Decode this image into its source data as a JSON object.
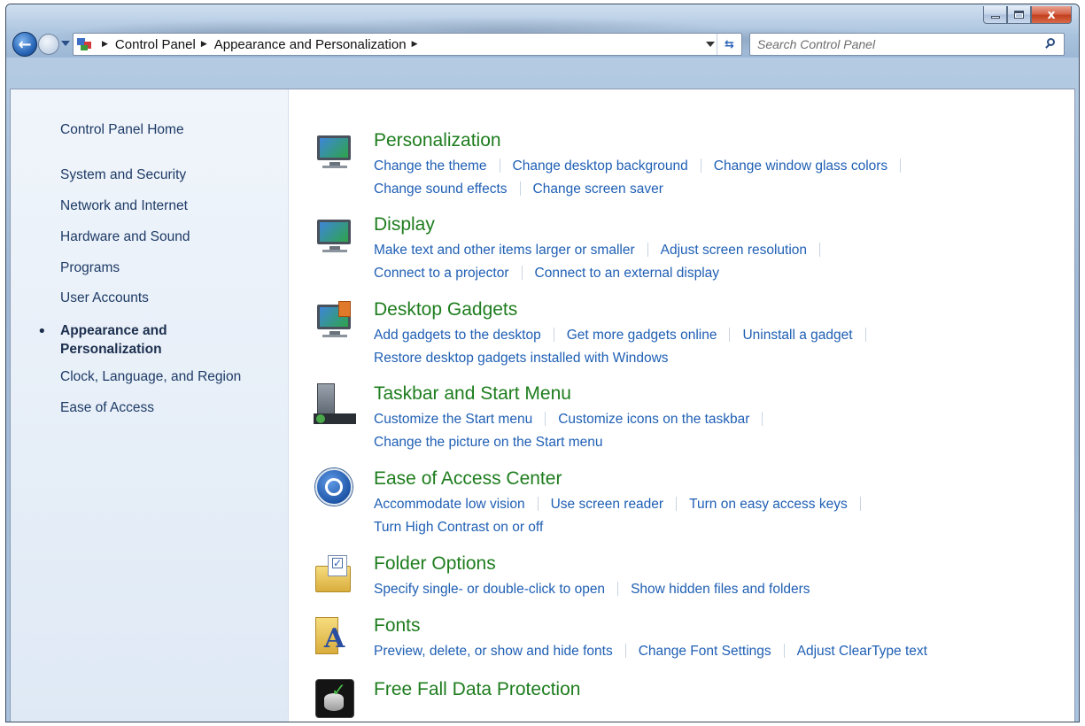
{
  "window": {
    "caption_close": "x"
  },
  "navigation": {
    "breadcrumbs": [
      "Control Panel",
      "Appearance and Personalization"
    ],
    "search_placeholder": "Search Control Panel"
  },
  "sidebar": {
    "items": [
      {
        "label": "Control Panel Home"
      },
      {
        "label": "System and Security"
      },
      {
        "label": "Network and Internet"
      },
      {
        "label": "Hardware and Sound"
      },
      {
        "label": "Programs"
      },
      {
        "label": "User Accounts"
      },
      {
        "label": "Appearance and Personalization",
        "selected": true
      },
      {
        "label": "Clock, Language, and Region"
      },
      {
        "label": "Ease of Access"
      }
    ]
  },
  "categories": [
    {
      "title": "Personalization",
      "icon": "personalization-icon",
      "links": [
        "Change the theme",
        "Change desktop background",
        "Change window glass colors",
        "Change sound effects",
        "Change screen saver"
      ]
    },
    {
      "title": "Display",
      "icon": "display-icon",
      "links": [
        "Make text and other items larger or smaller",
        "Adjust screen resolution",
        "Connect to a projector",
        "Connect to an external display"
      ]
    },
    {
      "title": "Desktop Gadgets",
      "icon": "desktop-gadgets-icon",
      "links": [
        "Add gadgets to the desktop",
        "Get more gadgets online",
        "Uninstall a gadget",
        "Restore desktop gadgets installed with Windows"
      ]
    },
    {
      "title": "Taskbar and Start Menu",
      "icon": "taskbar-icon",
      "links": [
        "Customize the Start menu",
        "Customize icons on the taskbar",
        "Change the picture on the Start menu"
      ]
    },
    {
      "title": "Ease of Access Center",
      "icon": "ease-of-access-icon",
      "links": [
        "Accommodate low vision",
        "Use screen reader",
        "Turn on easy access keys",
        "Turn High Contrast on or off"
      ]
    },
    {
      "title": "Folder Options",
      "icon": "folder-options-icon",
      "links": [
        "Specify single- or double-click to open",
        "Show hidden files and folders"
      ]
    },
    {
      "title": "Fonts",
      "icon": "fonts-icon",
      "links": [
        "Preview, delete, or show and hide fonts",
        "Change Font Settings",
        "Adjust ClearType text"
      ]
    },
    {
      "title": "Free Fall Data Protection",
      "icon": "free-fall-data-protection-icon",
      "links": []
    }
  ],
  "colors": {
    "category_title": "#1e7d1e",
    "link": "#1f5fb4",
    "sidebar_text": "#1e3b66"
  }
}
